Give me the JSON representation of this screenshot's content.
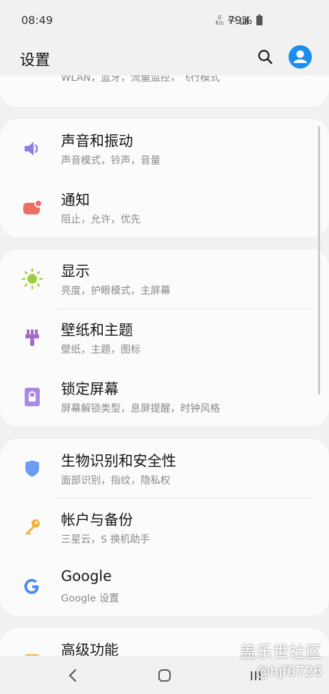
{
  "status_bar": {
    "time": "08:49",
    "net_speed_top": "0",
    "net_speed_unit": "K/s",
    "net_type": "4G",
    "battery": "79%"
  },
  "header": {
    "title": "设置",
    "search_icon": "search-icon",
    "account_icon": "account-icon"
  },
  "connections_partial": {
    "subtitle": "WLAN，蓝牙，流量监控，飞行模式"
  },
  "card1": {
    "items": [
      {
        "title": "声音和振动",
        "subtitle": "声音模式，铃声，音量"
      },
      {
        "title": "通知",
        "subtitle": "阻止，允许，优先"
      }
    ]
  },
  "card2": {
    "items": [
      {
        "title": "显示",
        "subtitle": "亮度，护眼模式，主屏幕"
      },
      {
        "title": "壁纸和主题",
        "subtitle": "壁纸，主题，图标"
      },
      {
        "title": "锁定屏幕",
        "subtitle": "屏幕解锁类型，息屏提醒，时钟风格"
      }
    ]
  },
  "card3": {
    "items": [
      {
        "title": "生物识别和安全性",
        "subtitle": "面部识别，指纹，隐私权"
      },
      {
        "title": "帐户与备份",
        "subtitle": "三星云，S 换机助手"
      },
      {
        "title": "Google",
        "subtitle": "Google 设置"
      }
    ]
  },
  "card4": {
    "items": [
      {
        "title": "高级功能"
      }
    ]
  },
  "watermark": {
    "line1": "盖乐世社区",
    "line2": "@hjf0726"
  },
  "colors": {
    "sound": "#8a7fe0",
    "notification": "#ee6d63",
    "display": "#9ccd3b",
    "wallpaper": "#a36acb",
    "lock": "#a78be0",
    "security": "#6d9bf0",
    "account": "#f2b136",
    "google_blue": "#4a8af4",
    "advanced": "#f2b136",
    "account_avatar": "#1a8ef0"
  }
}
